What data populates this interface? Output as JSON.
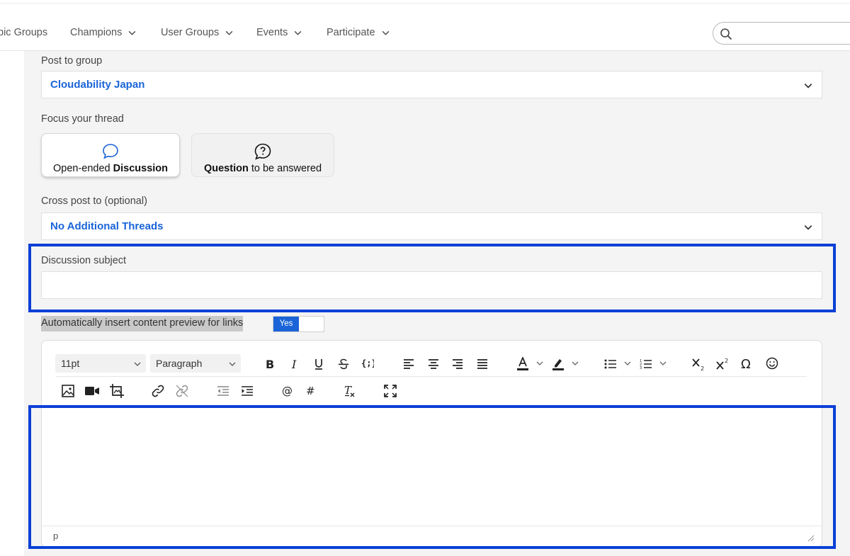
{
  "nav": {
    "items": [
      {
        "label": "pic Groups",
        "has_dropdown": false
      },
      {
        "label": "Champions",
        "has_dropdown": true
      },
      {
        "label": "User Groups",
        "has_dropdown": true
      },
      {
        "label": "Events",
        "has_dropdown": true
      },
      {
        "label": "Participate",
        "has_dropdown": true
      }
    ],
    "search": {
      "value": "",
      "placeholder": "",
      "icon": "search-icon"
    }
  },
  "form": {
    "post_to_group": {
      "label": "Post to group",
      "value": "Cloudability Japan"
    },
    "focus": {
      "label": "Focus your thread",
      "options": [
        {
          "pre": "Open-ended ",
          "bold": "Discussion",
          "post": "",
          "icon": "speech-bubble-icon",
          "selected": true
        },
        {
          "pre": "",
          "bold": "Question",
          "post": " to be answered",
          "icon": "question-bubble-icon",
          "selected": false
        }
      ]
    },
    "cross_post": {
      "label": "Cross post to (optional)",
      "value": "No Additional Threads"
    },
    "subject": {
      "label": "Discussion subject",
      "value": ""
    },
    "preview_links": {
      "label": "Automatically insert content preview for links",
      "toggle": "Yes",
      "enabled": true
    },
    "editor": {
      "font_size": "11pt",
      "block_format": "Paragraph",
      "status_path": "p",
      "toolbar_icons": [
        "bold-icon",
        "italic-icon",
        "underline-icon",
        "strikethrough-icon",
        "code-icon",
        "align-left-icon",
        "align-center-icon",
        "align-right-icon",
        "align-justify-icon",
        "text-color-icon",
        "highlight-color-icon",
        "bullet-list-icon",
        "numbered-list-icon",
        "subscript-icon",
        "superscript-icon",
        "special-character-icon",
        "emoji-icon",
        "image-icon",
        "video-icon",
        "crop-image-icon",
        "link-icon",
        "unlink-icon",
        "outdent-icon",
        "indent-icon",
        "mention-icon",
        "hashtag-icon",
        "clear-formatting-icon",
        "fullscreen-icon"
      ]
    }
  },
  "colors": {
    "accent": "#1a64d8",
    "highlight_border": "#0b3fd6",
    "panel_bg": "#f4f4f4"
  }
}
